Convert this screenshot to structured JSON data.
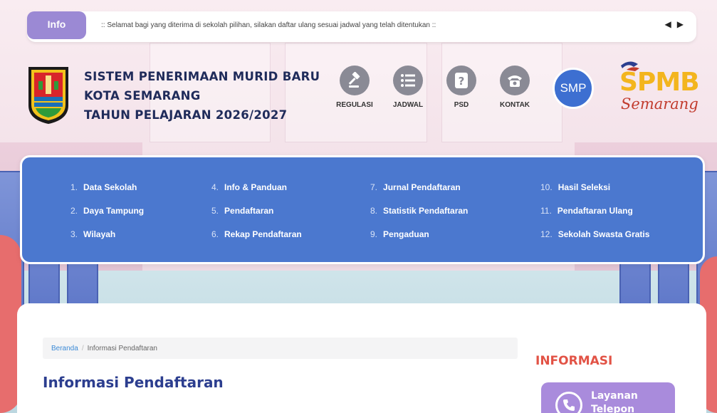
{
  "ticker": {
    "badge": "Info",
    "message": ":: Selamat bagi yang diterima di sekolah pilihan, silakan daftar ulang sesuai jadwal yang telah ditentukan ::",
    "prev": "◀",
    "next": "▶"
  },
  "header": {
    "title_line1": "SISTEM PENERIMAAN MURID BARU",
    "title_line2": "KOTA SEMARANG",
    "title_line3": "TAHUN PELAJARAN 2026/2027",
    "nav": [
      {
        "label": "REGULASI",
        "icon": "gavel-icon"
      },
      {
        "label": "JADWAL",
        "icon": "list-icon"
      },
      {
        "label": "PSD",
        "icon": "question-icon"
      },
      {
        "label": "KONTAK",
        "icon": "telephone-icon"
      }
    ],
    "level": "SMP",
    "brand_main": "SPMB",
    "brand_sub": "Semarang"
  },
  "menu": {
    "items": [
      {
        "num": "1.",
        "label": "Data Sekolah"
      },
      {
        "num": "2.",
        "label": "Daya Tampung"
      },
      {
        "num": "3.",
        "label": "Wilayah"
      },
      {
        "num": "4.",
        "label": "Info & Panduan"
      },
      {
        "num": "5.",
        "label": "Pendaftaran"
      },
      {
        "num": "6.",
        "label": "Rekap Pendaftaran"
      },
      {
        "num": "7.",
        "label": "Jurnal Pendaftaran"
      },
      {
        "num": "8.",
        "label": "Statistik Pendaftaran"
      },
      {
        "num": "9.",
        "label": "Pengaduan"
      },
      {
        "num": "10.",
        "label": "Hasil Seleksi"
      },
      {
        "num": "11.",
        "label": "Pendaftaran Ulang"
      },
      {
        "num": "12.",
        "label": "Sekolah Swasta Gratis"
      }
    ]
  },
  "breadcrumb": {
    "home": "Beranda",
    "separator": "/",
    "current": "Informasi Pendaftaran"
  },
  "main": {
    "title": "Informasi Pendaftaran"
  },
  "sidebar": {
    "heading": "INFORMASI",
    "service_label": "Layanan Telepon"
  },
  "colors": {
    "menu_bg": "#4b78cf",
    "badge": "#9b89d4",
    "smp": "#3d6fd1",
    "heading_red": "#e25346",
    "title_navy": "#2c3e8f"
  }
}
